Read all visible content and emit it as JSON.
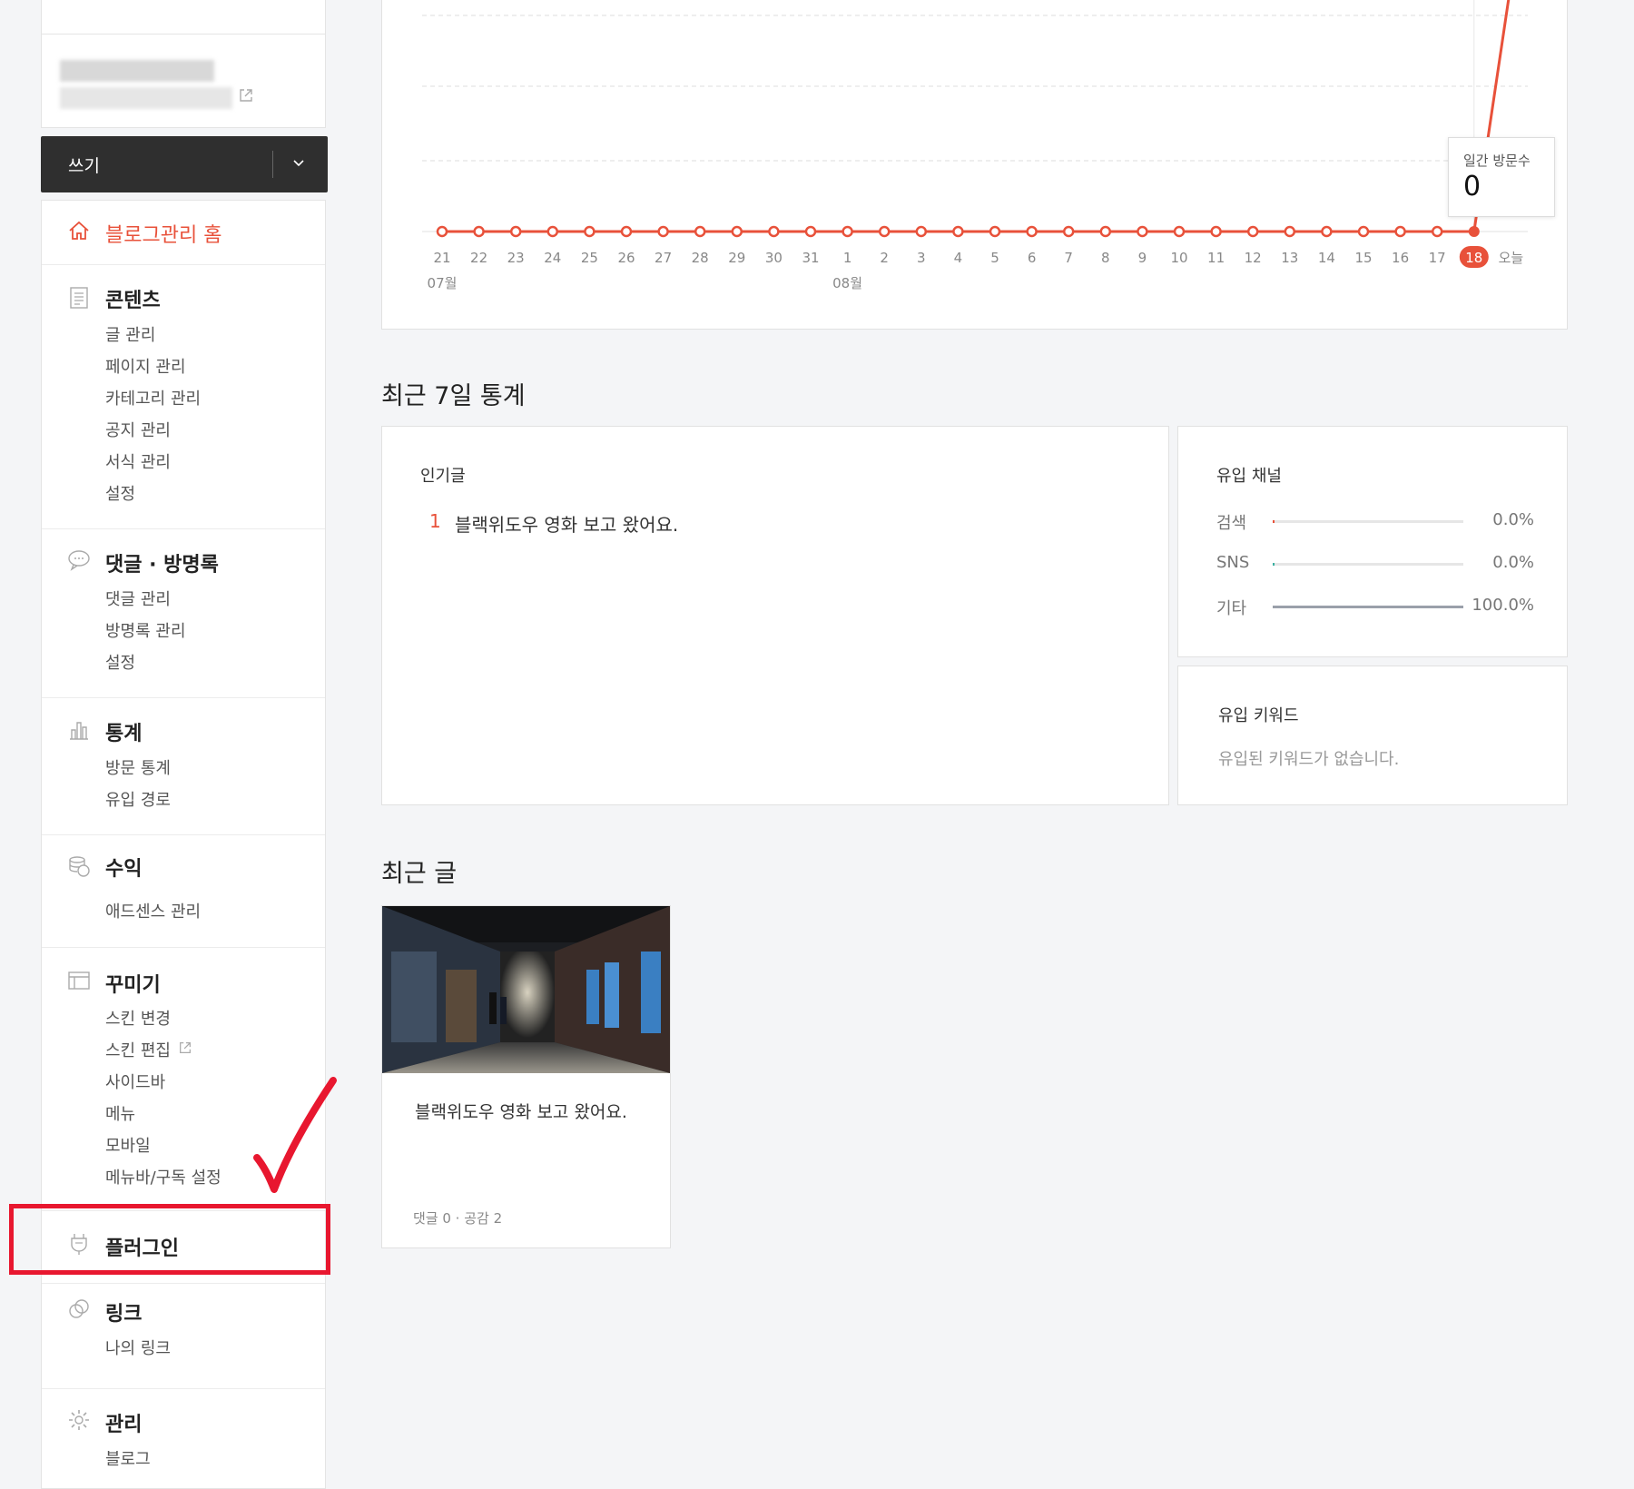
{
  "sidebar": {
    "write_label": "쓰기",
    "home_label": "블로그관리 홈",
    "sections": {
      "contents": {
        "title": "콘텐츠",
        "items": [
          "글 관리",
          "페이지 관리",
          "카테고리 관리",
          "공지 관리",
          "서식 관리",
          "설정"
        ]
      },
      "comments": {
        "title": "댓글 · 방명록",
        "items": [
          "댓글 관리",
          "방명록 관리",
          "설정"
        ]
      },
      "stats": {
        "title": "통계",
        "items": [
          "방문 통계",
          "유입 경로"
        ]
      },
      "revenue": {
        "title": "수익",
        "items": [
          "애드센스 관리"
        ]
      },
      "decorate": {
        "title": "꾸미기",
        "items": [
          "스킨 변경",
          "스킨 편집",
          "사이드바",
          "메뉴",
          "모바일",
          "메뉴바/구독 설정"
        ]
      },
      "plugin": {
        "title": "플러그인"
      },
      "link": {
        "title": "링크",
        "items": [
          "나의 링크"
        ]
      },
      "manage": {
        "title": "관리",
        "items": [
          "블로그"
        ]
      }
    }
  },
  "chart_data": {
    "type": "line",
    "title": "",
    "x_labels": [
      "21",
      "22",
      "23",
      "24",
      "25",
      "26",
      "27",
      "28",
      "29",
      "30",
      "31",
      "1",
      "2",
      "3",
      "4",
      "5",
      "6",
      "7",
      "8",
      "9",
      "10",
      "11",
      "12",
      "13",
      "14",
      "15",
      "16",
      "17",
      "18",
      "오늘"
    ],
    "month_labels": {
      "start": "07월",
      "august": "08월"
    },
    "series": [
      {
        "values": [
          0,
          0,
          0,
          0,
          0,
          0,
          0,
          0,
          0,
          0,
          0,
          0,
          0,
          0,
          0,
          0,
          0,
          0,
          0,
          0,
          0,
          0,
          0,
          0,
          0,
          0,
          0,
          0,
          0
        ]
      }
    ],
    "highlighted": "18",
    "color": "#e8513a"
  },
  "tooltip": {
    "label": "일간 방문수",
    "value": "0"
  },
  "stats7": {
    "title": "최근 7일 통계",
    "popular": {
      "title": "인기글",
      "items": [
        {
          "rank": "1",
          "title": "블랙위도우 영화 보고 왔어요."
        }
      ]
    },
    "channels": {
      "title": "유입 채널",
      "rows": [
        {
          "name": "검색",
          "pct": "0.0%",
          "value": 0.0,
          "color": "#e8513a"
        },
        {
          "name": "SNS",
          "pct": "0.0%",
          "value": 0.0,
          "color": "#3ab0a0"
        },
        {
          "name": "기타",
          "pct": "100.0%",
          "value": 100.0,
          "color": "#9aa0aa"
        }
      ]
    },
    "keywords": {
      "title": "유입 키워드",
      "empty": "유입된 키워드가 없습니다."
    }
  },
  "recent": {
    "title": "최근 글",
    "post": {
      "title": "블랙위도우 영화 보고 왔어요.",
      "meta": "댓글 0 · 공감 2"
    }
  },
  "colors": {
    "accent": "#e8513a",
    "annotation": "#e8172f",
    "dark_button": "#2f2f2f"
  }
}
